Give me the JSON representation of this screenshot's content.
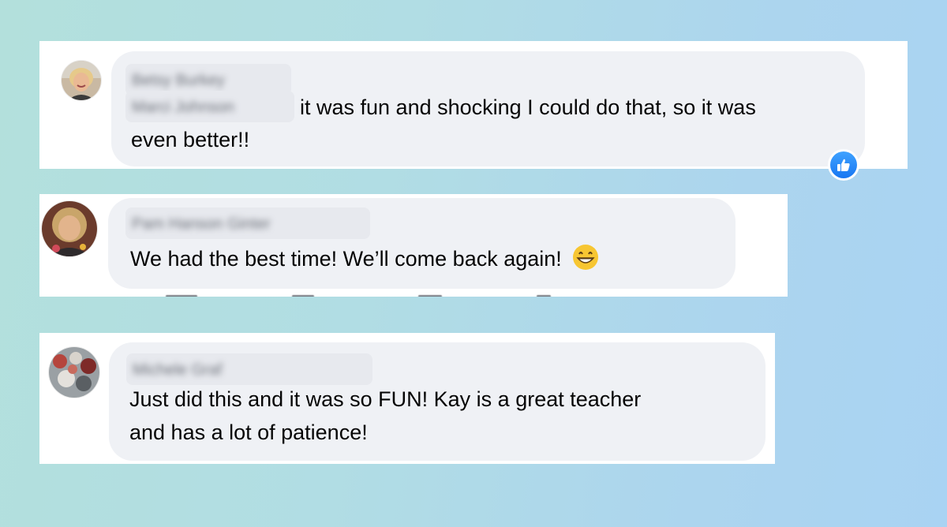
{
  "comments": [
    {
      "author": "Betsy Burkey",
      "tagged_name": "Marci Johnson",
      "text_line1": "it was fun and shocking I could do that, so it was",
      "text_line2": "even better!!",
      "reaction_icon": "thumbs-up-icon"
    },
    {
      "author": "Pam Hanson Ginter",
      "text_line1": "We had the best time! We’ll come back again!",
      "emoji_icon": "grinning-face-emoji"
    },
    {
      "author": "Michele Graf",
      "text_line1": "Just did this and it was so FUN! Kay is a great teacher",
      "text_line2": "and has a lot of patience!"
    }
  ],
  "colors": {
    "bubble": "#eff1f5",
    "like_blue": "#1877f2",
    "text": "#050505"
  }
}
